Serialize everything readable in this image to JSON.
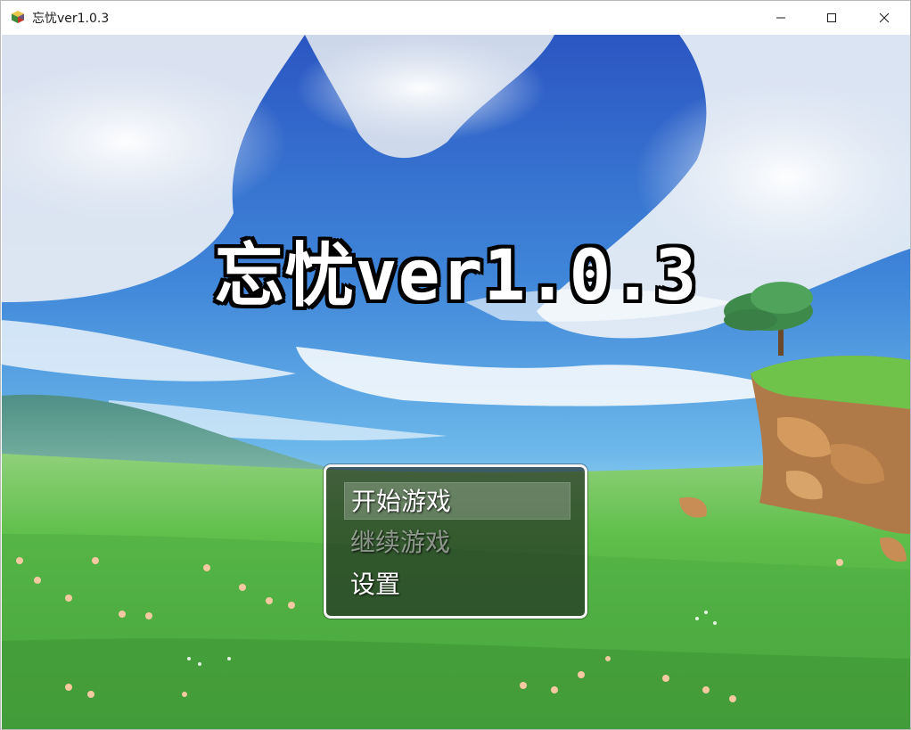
{
  "window": {
    "title": "忘忧ver1.0.3",
    "icon": "rpgmaker-cube-icon"
  },
  "titlebar_buttons": {
    "minimize": "minimize-icon",
    "maximize": "maximize-icon",
    "close": "close-icon"
  },
  "game": {
    "title": "忘忧ver1.0.3",
    "menu": {
      "items": [
        {
          "label": "开始游戏",
          "state": "selected"
        },
        {
          "label": "继续游戏",
          "state": "disabled"
        },
        {
          "label": "设置",
          "state": "enabled"
        }
      ]
    }
  },
  "colors": {
    "sky_top": "#2f5fc9",
    "sky_mid": "#4c9ee0",
    "grass": "#5fbf4a",
    "menu_bg": "#1e2620",
    "menu_border": "#f4f4f4",
    "title_text": "#ffffff",
    "title_outline": "#000000"
  }
}
